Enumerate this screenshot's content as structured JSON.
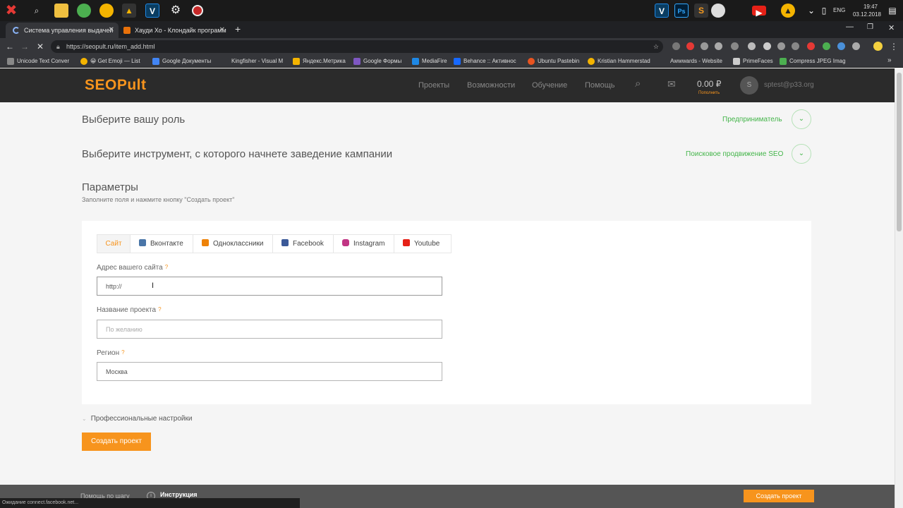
{
  "taskbar": {
    "clock_time": "19:47",
    "clock_date": "03.12.2018",
    "lang": "ENG"
  },
  "browser": {
    "tabs": [
      {
        "title": "Система управления выдачей"
      },
      {
        "title": "Хауди Хо - Клондайк программ"
      }
    ],
    "url": "https://seopult.ru/item_add.html",
    "bookmarks": [
      {
        "label": "Unicode Text Conver"
      },
      {
        "label": "😀 Get Emoji — List"
      },
      {
        "label": "Google Документы"
      },
      {
        "label": "Kingfisher - Visual M"
      },
      {
        "label": "Яндекс.Метрика"
      },
      {
        "label": "Google Формы"
      },
      {
        "label": "MediaFire"
      },
      {
        "label": "Behance :: Активнос"
      },
      {
        "label": "Ubuntu Pastebin"
      },
      {
        "label": "Kristian Hammerstad"
      },
      {
        "label": "Awwwards - Website"
      },
      {
        "label": "PrimeFaces"
      },
      {
        "label": "Compress JPEG Imag"
      }
    ],
    "status_text": "Ожидание connect.facebook.net..."
  },
  "site": {
    "logo": "SEOPult",
    "nav": [
      "Проекты",
      "Возможности",
      "Обучение",
      "Помощь"
    ],
    "balance": "0.00 ₽",
    "balance_sub": "Пополнить",
    "avatar_letter": "S",
    "user_email": "sptest@p33.org"
  },
  "main": {
    "role_title": "Выберите вашу роль",
    "role_value": "Предприниматель",
    "tool_title": "Выберите инструмент, с которого начнете заведение кампании",
    "tool_value": "Поисковое продвижение SEO",
    "params_title": "Параметры",
    "params_subtitle": "Заполните поля и нажмите кнопку \"Создать проект\"",
    "tabs": [
      {
        "label": "Сайт",
        "icon": "",
        "color": ""
      },
      {
        "label": "Вконтакте",
        "icon": "vk-icon",
        "color": "#4a76a8"
      },
      {
        "label": "Одноклассники",
        "icon": "ok-icon",
        "color": "#ee8208"
      },
      {
        "label": "Facebook",
        "icon": "facebook-icon",
        "color": "#3b5998"
      },
      {
        "label": "Instagram",
        "icon": "instagram-icon",
        "color": "#c13584"
      },
      {
        "label": "Youtube",
        "icon": "youtube-icon",
        "color": "#e62117"
      }
    ],
    "fields": {
      "site_label": "Адрес вашего сайта",
      "site_value": "http://",
      "name_label": "Название проекта",
      "name_placeholder": "По желанию",
      "region_label": "Регион",
      "region_value": "Москва",
      "hint_mark": "?"
    },
    "pro_settings": "Профессиональные настройки",
    "create_button": "Создать проект"
  },
  "footer": {
    "help": "Помощь по шагу",
    "instruction": "Инструкция",
    "button": "Создать проект"
  },
  "colors": {
    "accent": "#f7941d",
    "green": "#44b54a",
    "header_bg": "#2b2b2b"
  }
}
